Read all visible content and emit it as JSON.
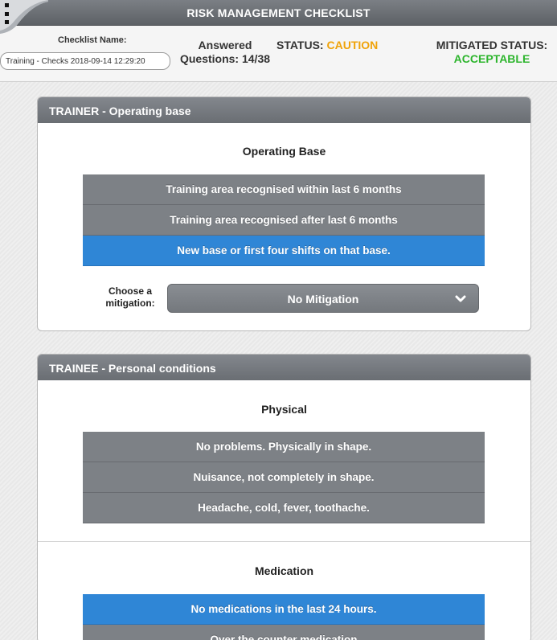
{
  "titlebar": {
    "title": "RISK MANAGEMENT CHECKLIST"
  },
  "header": {
    "checklist_name_label": "Checklist Name:",
    "checklist_name_value": "Training - Checks 2018-09-14 12:29:20",
    "answered_label": "Answered",
    "answered_value": "Questions: 14/38",
    "status_label": "STATUS:",
    "status_value": "CAUTION",
    "mitigated_label": "MITIGATED STATUS:",
    "mitigated_value": "ACCEPTABLE"
  },
  "panels": [
    {
      "title": "TRAINER - Operating base",
      "sections": [
        {
          "title": "Operating Base",
          "options": [
            "Training area recognised within last 6 months",
            "Training area recognised after last 6 months",
            "New base or first four shifts on that base."
          ],
          "selected_index": 2,
          "mitigation_label": "Choose a mitigation:",
          "mitigation_value": "No Mitigation"
        }
      ]
    },
    {
      "title": "TRAINEE - Personal conditions",
      "sections": [
        {
          "title": "Physical",
          "options": [
            "No problems. Physically in shape.",
            "Nuisance, not completely in shape.",
            "Headache, cold, fever, toothache."
          ],
          "selected_index": -1
        },
        {
          "title": "Medication",
          "options": [
            "No medications in the last 24 hours.",
            "Over the counter medication"
          ],
          "selected_index": 0
        }
      ]
    }
  ],
  "colors": {
    "caution": "#f0a30a",
    "acceptable": "#2db52d",
    "selected": "#2f86d6",
    "option": "#7d8186"
  }
}
